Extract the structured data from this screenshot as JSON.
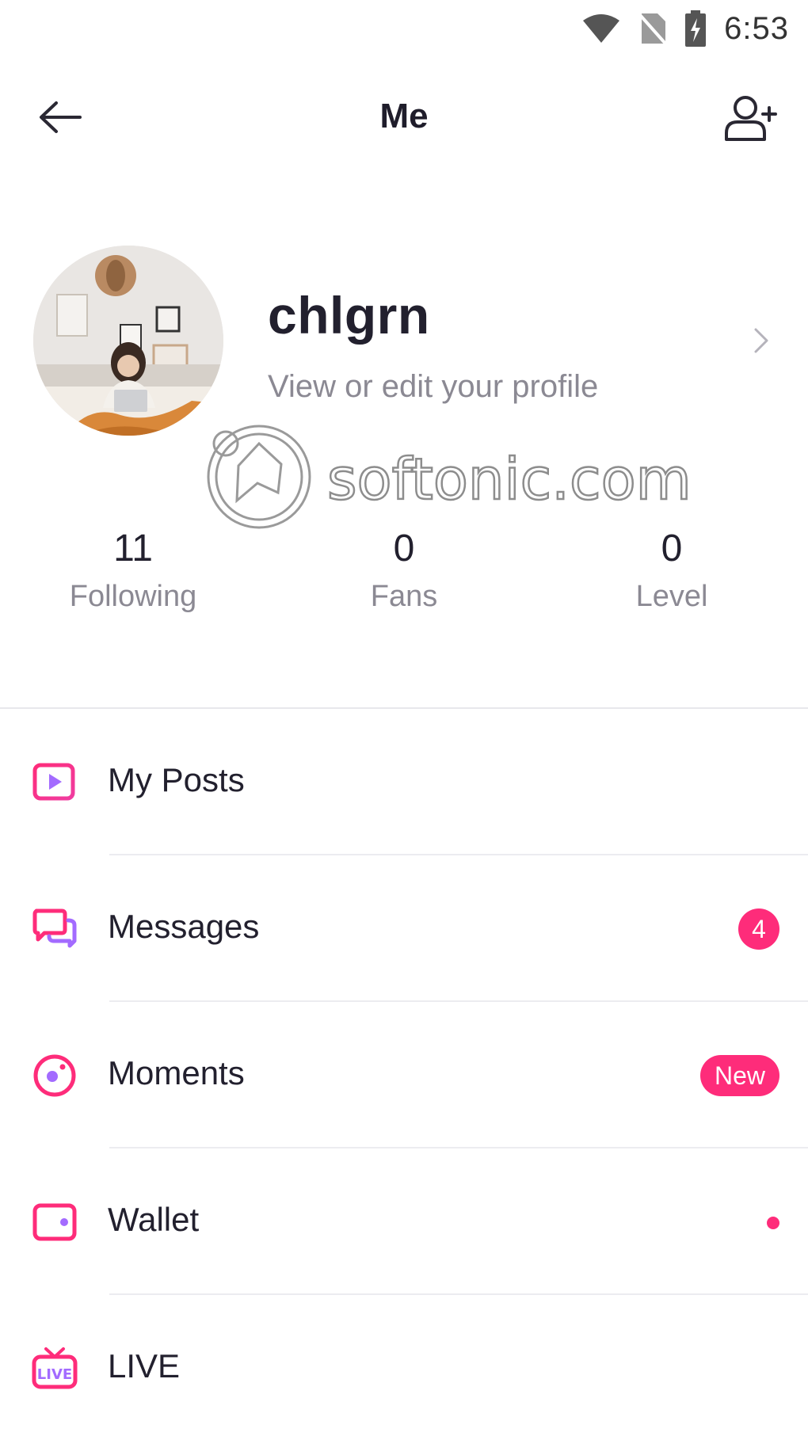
{
  "status_bar": {
    "time": "6:53"
  },
  "header": {
    "title": "Me"
  },
  "profile": {
    "username": "chlgrn",
    "subtitle": "View or edit your profile"
  },
  "watermark": {
    "text": "softonic.com"
  },
  "stats": [
    {
      "value": "11",
      "label": "Following"
    },
    {
      "value": "0",
      "label": "Fans"
    },
    {
      "value": "0",
      "label": "Level"
    }
  ],
  "menu": {
    "items": [
      {
        "label": "My Posts",
        "icon": "play-square-icon"
      },
      {
        "label": "Messages",
        "icon": "chat-bubbles-icon",
        "badge": "4"
      },
      {
        "label": "Moments",
        "icon": "moments-icon",
        "badge": "New"
      },
      {
        "label": "Wallet",
        "icon": "wallet-icon"
      },
      {
        "label": "LIVE",
        "icon": "live-tv-icon",
        "icon_text": "LIVE"
      }
    ]
  },
  "colors": {
    "accent": "#fe2c7a",
    "accent_purple": "#a36bff",
    "text": "#22202e",
    "muted": "#8b8993"
  }
}
